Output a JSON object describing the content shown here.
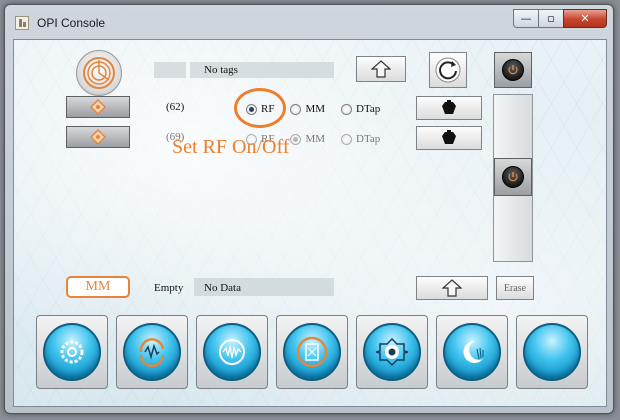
{
  "window": {
    "title": "OPI Console",
    "controls": {
      "minimize": "—",
      "maximize": "▫",
      "close": "✕"
    }
  },
  "tag_row": {
    "value": "No tags"
  },
  "channels": [
    {
      "count": "(62)",
      "options": [
        "RF",
        "MM",
        "DTap"
      ],
      "selected": "RF",
      "enabled": true
    },
    {
      "count": "(69)",
      "options": [
        "RF",
        "MM",
        "DTap"
      ],
      "selected": "MM",
      "enabled": false
    }
  ],
  "annotation": {
    "text": "Set RF On/Off",
    "color": "#ee7f2e"
  },
  "mm_row": {
    "badge": "MM",
    "status": "Empty",
    "value": "No Data",
    "erase_label": "Erase"
  },
  "bottom_toolbar": [
    {
      "icon": "gear-orb-icon"
    },
    {
      "icon": "refresh-wave-orb-icon"
    },
    {
      "icon": "waveform-orb-icon"
    },
    {
      "icon": "card-orb-icon"
    },
    {
      "icon": "eye-orb-icon"
    },
    {
      "icon": "moon-orb-icon"
    },
    {
      "icon": "blank-orb-icon"
    }
  ],
  "colors": {
    "accent_orange": "#ee7f2e",
    "orb_blue": "#2bb6e6"
  }
}
